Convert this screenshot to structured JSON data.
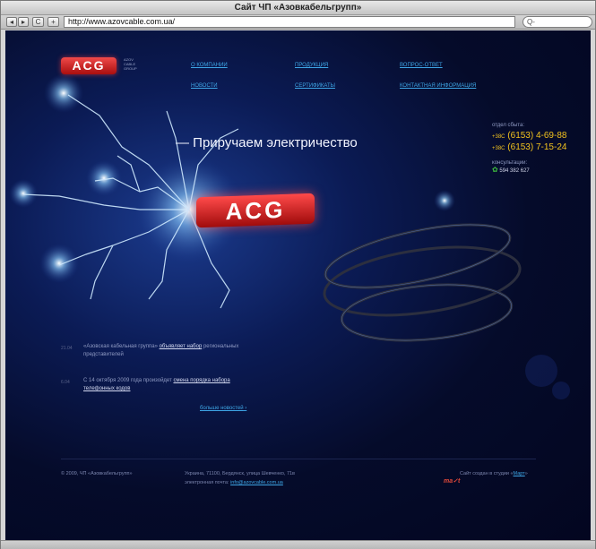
{
  "window": {
    "title": "Сайт ЧП «Азовкабельгрупп»"
  },
  "browser": {
    "back_label": "◂",
    "forward_label": "▸",
    "reload_label": "C",
    "add_label": "+",
    "url": "http://www.azovcable.com.ua/",
    "search_placeholder": "Q-"
  },
  "logo": {
    "text": "ACG",
    "subtitle_1": "AZOV",
    "subtitle_2": "CABLE",
    "subtitle_3": "GROUP"
  },
  "hero_logo": {
    "text": "ACG"
  },
  "menu": [
    "О КОМПАНИИ",
    "ПРОДУКЦИЯ",
    "ВОПРОС-ОТВЕТ",
    "НОВОСТИ",
    "СЕРТИФИКАТЫ",
    "КОНТАКТНАЯ ИНФОРМАЦИЯ"
  ],
  "slogan": "— Приручаем электричество",
  "contacts": {
    "sales_label": "отдел сбыта:",
    "phone_prefix": "+38С",
    "phone_1": "(6153) 4-69-88",
    "phone_2": "(6153) 7-15-24",
    "consult_label": "консультации:",
    "icq": "594 382 627"
  },
  "news": [
    {
      "date": "21.04",
      "text_a": "«Азовская кабельная группа»",
      "link": "объявляет набор",
      "text_b": "региональных",
      "text_c": "представителей"
    },
    {
      "date": "6.04",
      "text_a": "С 14 октября 2009 года произойдет",
      "link": "смена порядка набора",
      "link_2": "телефонных кодов"
    }
  ],
  "more_news": "больше новостей",
  "more_news_arrow": "›",
  "footer": {
    "copyright": "© 2009, ЧП «Азовкабельгрупп»",
    "address": "Украина, 71100, Бердянск, улица Шевченко, 71в",
    "email_label": "электронная почта:",
    "email": "info@azovcable.com.ua",
    "studio_text": "Сайт создан в студии «",
    "studio_link": "Март",
    "studio_end": "»",
    "studio_logo": "ma✓t"
  }
}
